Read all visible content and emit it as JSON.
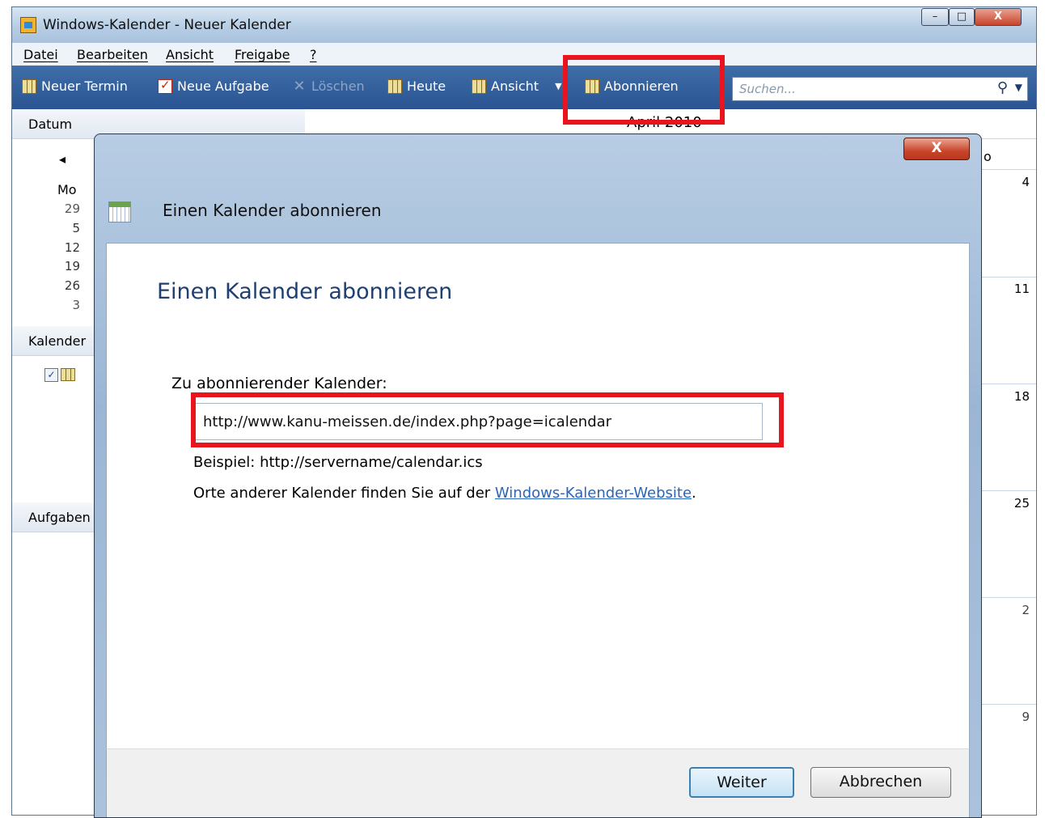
{
  "window": {
    "title": "Windows-Kalender - Neuer Kalender",
    "controls": {
      "minimize": "–",
      "maximize": "□",
      "close": "X"
    }
  },
  "menu": [
    "Datei",
    "Bearbeiten",
    "Ansicht",
    "Freigabe",
    "?"
  ],
  "toolbar": {
    "new_appointment": "Neuer Termin",
    "new_task": "Neue Aufgabe",
    "delete": "Löschen",
    "today": "Heute",
    "view": "Ansicht",
    "subscribe": "Abonnieren",
    "search_placeholder": "Suchen..."
  },
  "left_panel": {
    "date_header": "Datum",
    "prev_arrow": "◂",
    "weekday_first": "Mo",
    "day_numbers": [
      "29",
      "5",
      "12",
      "19",
      "26",
      "3"
    ],
    "calendars_header": "Kalender",
    "tasks_header": "Aufgaben"
  },
  "month_view": {
    "month_title": "April 2010",
    "column_fragment": "o",
    "right_column_days": [
      "4",
      "11",
      "18",
      "25",
      "2",
      "9"
    ]
  },
  "dialog": {
    "caption": "Einen Kalender abonnieren",
    "heading": "Einen Kalender abonnieren",
    "url_label": "Zu abonnierender Kalender:",
    "url_value": "http://www.kanu-meissen.de/index.php?page=icalendar",
    "example": "Beispiel: http://servername/calendar.ics",
    "find_prefix": "Orte anderer Kalender finden Sie auf der ",
    "find_link": "Windows-Kalender-Website",
    "find_suffix": ".",
    "next_button": "Weiter",
    "cancel_button": "Abbrechen",
    "close_glyph": "X"
  },
  "icons": {
    "app": "calendar-app-icon",
    "new_appointment": "calendar-grid-icon",
    "new_task": "task-check-icon",
    "delete": "delete-x-icon",
    "today": "calendar-grid-icon",
    "view": "calendar-grid-icon",
    "subscribe": "calendar-subscribe-icon",
    "search": "search-icon",
    "dialog": "calendar-icon"
  },
  "colors": {
    "toolbar": "#2f5b98",
    "heading": "#1f3f73",
    "link": "#2b64b8",
    "highlight": "#e8141e"
  }
}
